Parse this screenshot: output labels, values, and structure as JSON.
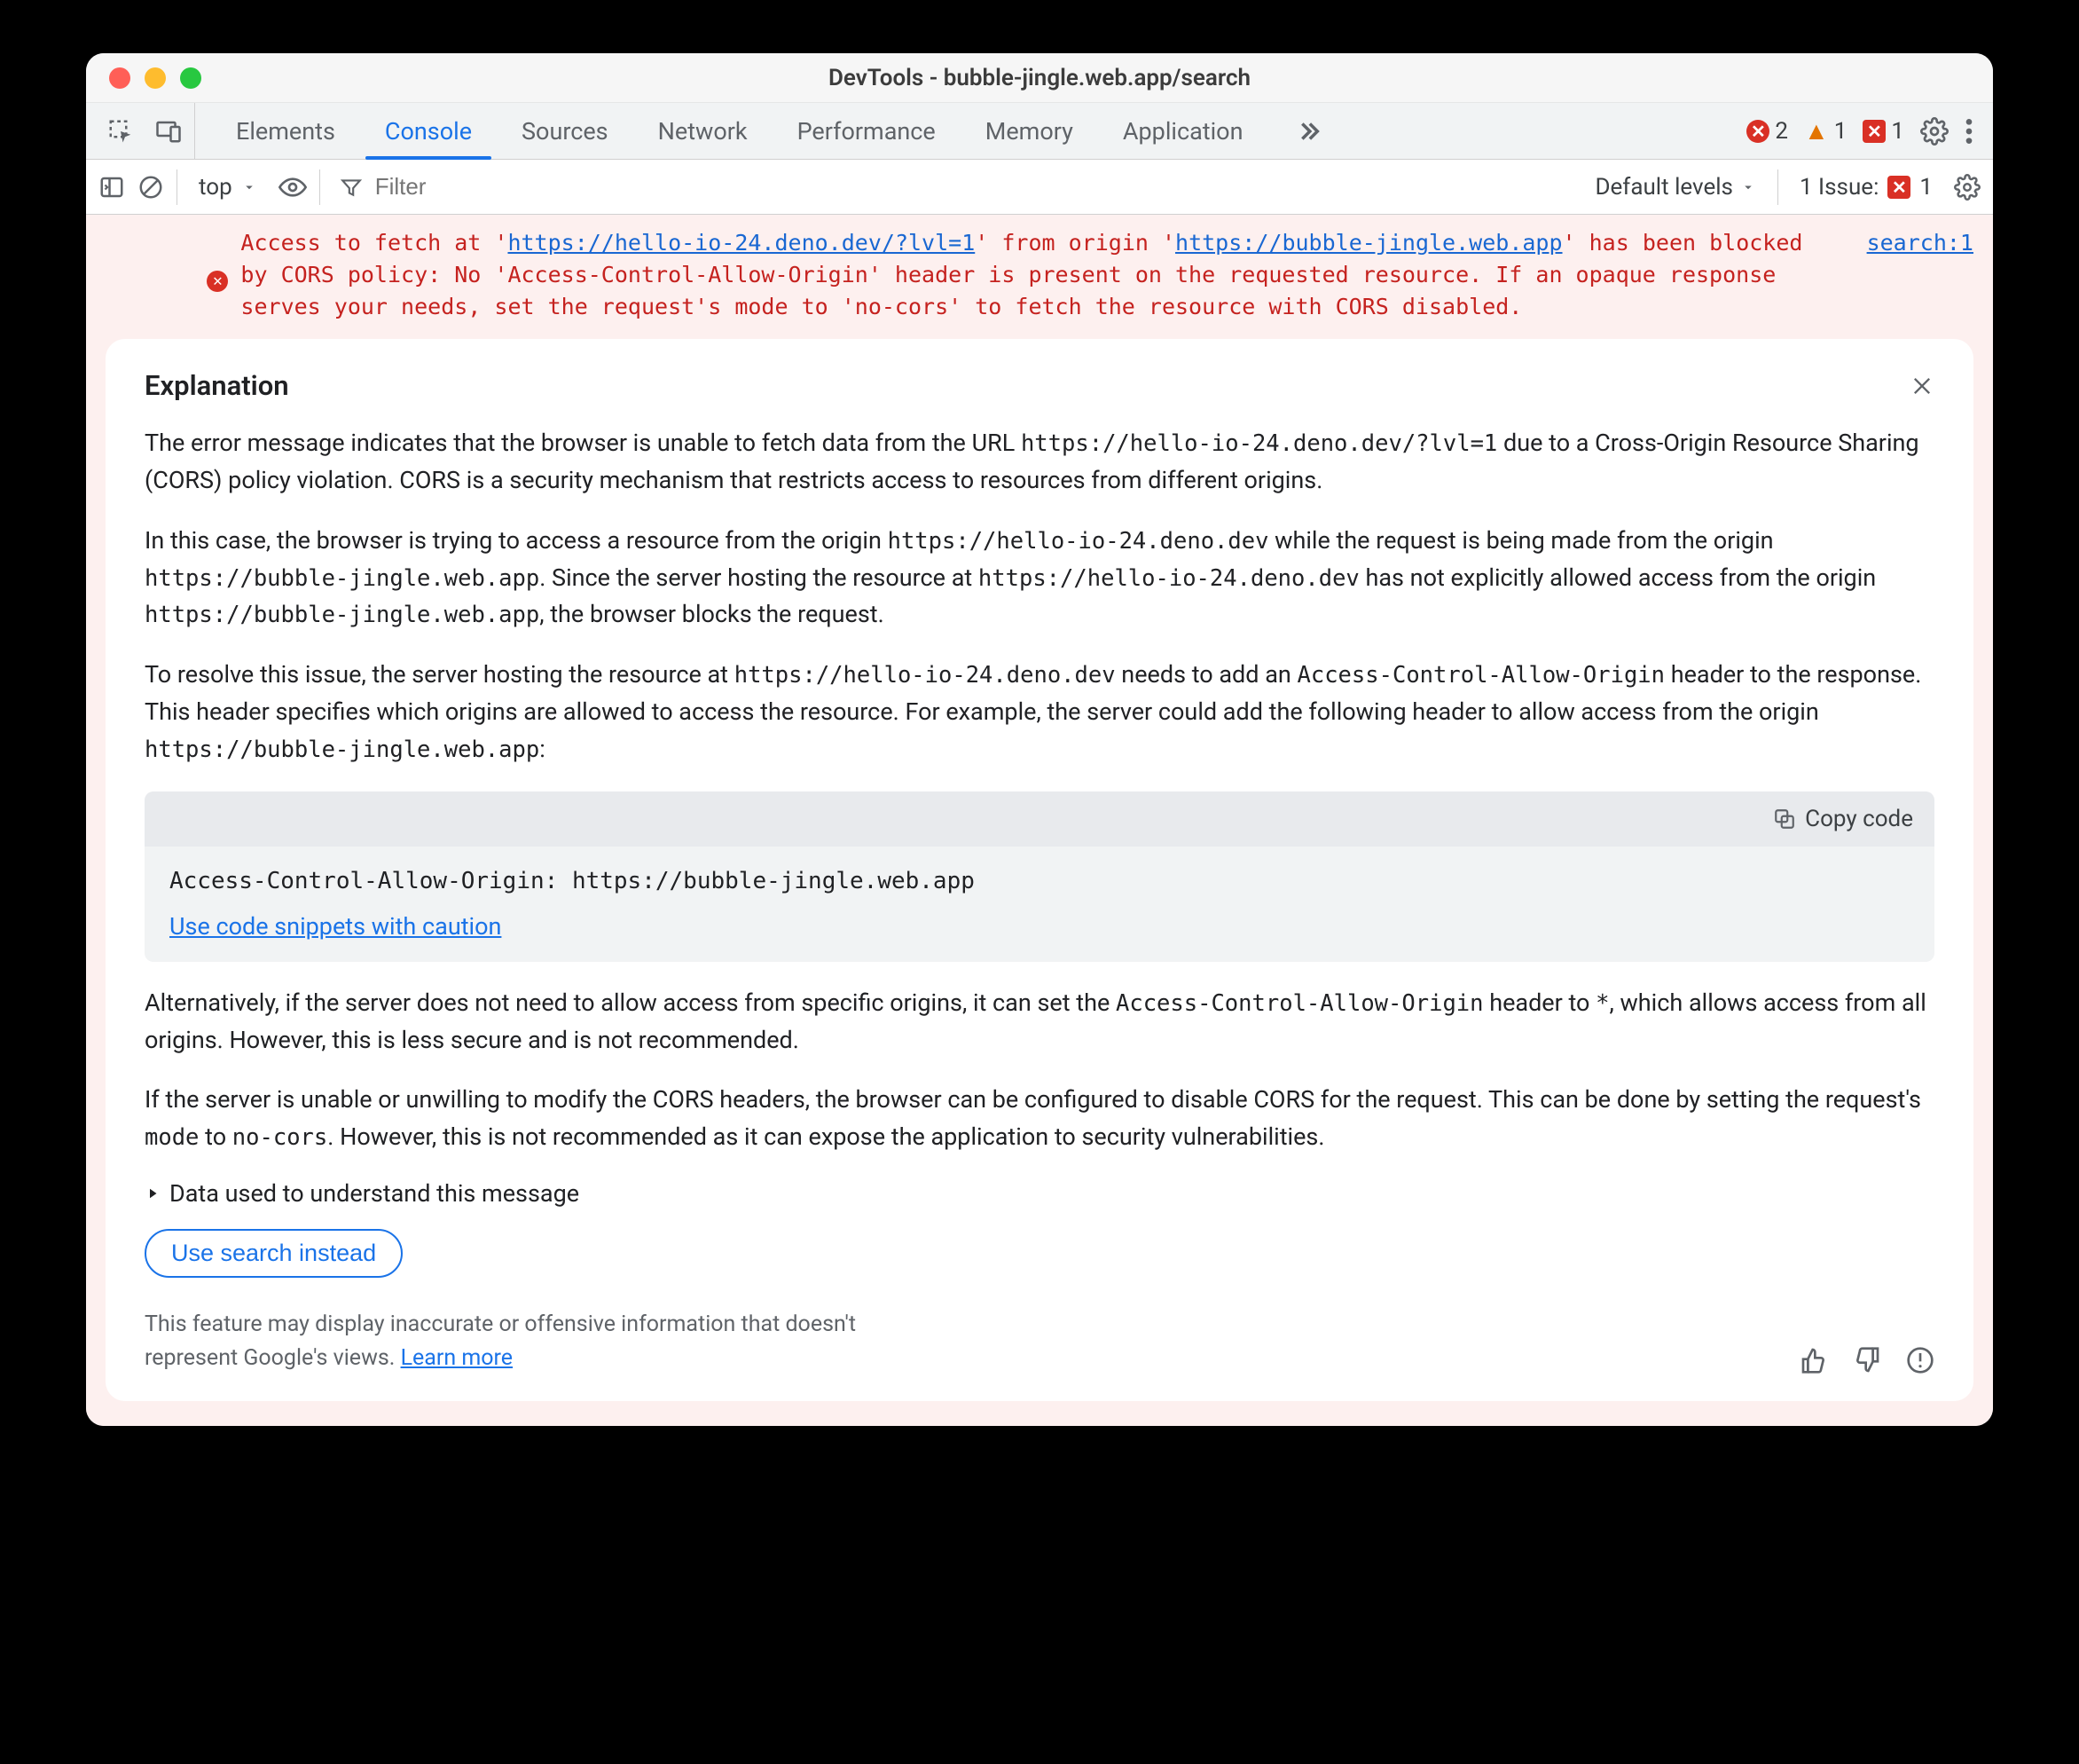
{
  "window": {
    "title": "DevTools - bubble-jingle.web.app/search"
  },
  "tabs": {
    "items": [
      "Elements",
      "Console",
      "Sources",
      "Network",
      "Performance",
      "Memory",
      "Application"
    ],
    "active": "Console"
  },
  "counters": {
    "errors": "2",
    "warnings": "1",
    "issues_badge": "1"
  },
  "subbar": {
    "context": "top",
    "filter_placeholder": "Filter",
    "levels_label": "Default levels",
    "issues_label": "1 Issue:",
    "issues_count": "1"
  },
  "error": {
    "pre1": "Access to fetch at '",
    "url1": "https://hello-io-24.deno.dev/?lvl=1",
    "mid1": "' from origin '",
    "url2": "https://bubble-jingle.web.app",
    "post": "' has been blocked by CORS policy: No 'Access-Control-Allow-Origin' header is present on the requested resource. If an opaque response serves your needs, set the request's mode to 'no-cors' to fetch the resource with CORS disabled.",
    "source": "search:1"
  },
  "explanation": {
    "title": "Explanation",
    "p1a": "The error message indicates that the browser is unable to fetch data from the URL ",
    "p1_code": "https://hello-io-24.deno.dev/?lvl=1",
    "p1b": " due to a Cross-Origin Resource Sharing (CORS) policy violation. CORS is a security mechanism that restricts access to resources from different origins.",
    "p2a": "In this case, the browser is trying to access a resource from the origin ",
    "p2_code1": "https://hello-io-24.deno.dev",
    "p2b": " while the request is being made from the origin ",
    "p2_code2": "https://bubble-jingle.web.app",
    "p2c": ". Since the server hosting the resource at ",
    "p2_code3": "https://hello-io-24.deno.dev",
    "p2d": " has not explicitly allowed access from the origin ",
    "p2_code4": "https://bubble-jingle.web.app",
    "p2e": ", the browser blocks the request.",
    "p3a": "To resolve this issue, the server hosting the resource at ",
    "p3_code1": "https://hello-io-24.deno.dev",
    "p3b": " needs to add an ",
    "p3_code2": "Access-Control-Allow-Origin",
    "p3c": " header to the response. This header specifies which origins are allowed to access the resource. For example, the server could add the following header to allow access from the origin ",
    "p3_code3": "https://bubble-jingle.web.app",
    "p3d": ":",
    "copy_label": "Copy code",
    "code": "Access-Control-Allow-Origin: https://bubble-jingle.web.app",
    "caution": "Use code snippets with caution",
    "p4a": "Alternatively, if the server does not need to allow access from specific origins, it can set the ",
    "p4_code1": "Access-Control-Allow-Origin",
    "p4b": " header to ",
    "p4_code2": "*",
    "p4c": ", which allows access from all origins. However, this is less secure and is not recommended.",
    "p5a": "If the server is unable or unwilling to modify the CORS headers, the browser can be configured to disable CORS for the request. This can be done by setting the request's ",
    "p5_code1": "mode",
    "p5b": " to ",
    "p5_code2": "no-cors",
    "p5c": ". However, this is not recommended as it can expose the application to security vulnerabilities.",
    "disclosure": "Data used to understand this message",
    "search_instead": "Use search instead",
    "disclaimer_a": "This feature may display inaccurate or offensive information that doesn't represent Google's views. ",
    "disclaimer_link": "Learn more"
  }
}
